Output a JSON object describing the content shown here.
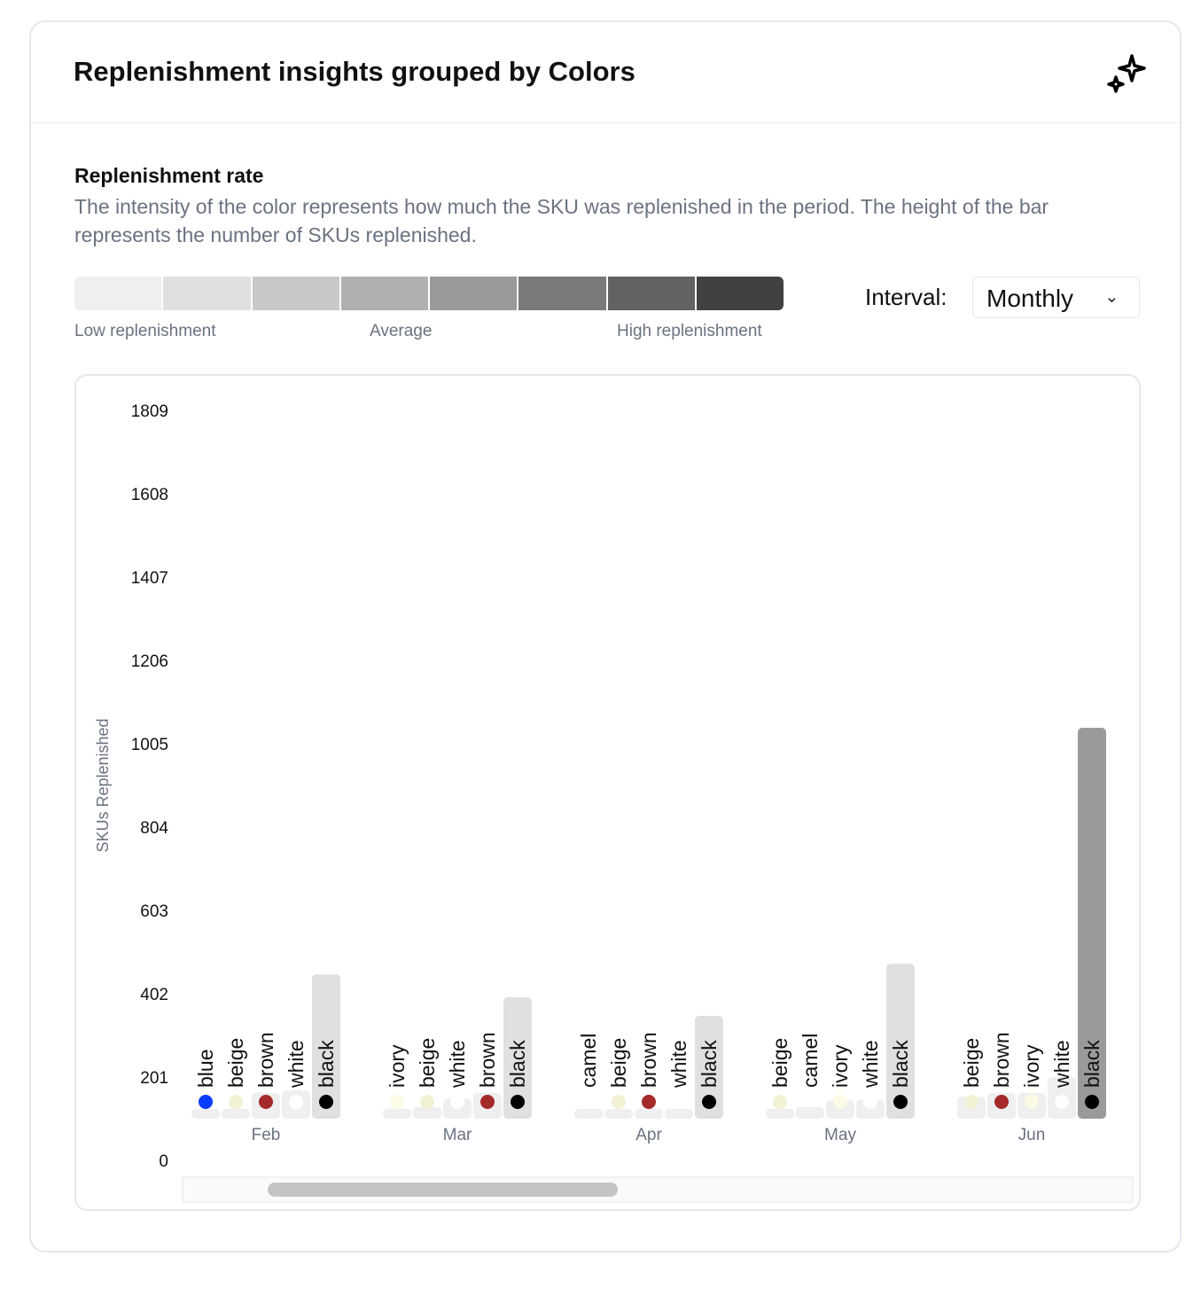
{
  "header": {
    "title": "Replenishment insights grouped by Colors",
    "icon": "sparkles-icon"
  },
  "section": {
    "title": "Replenishment rate",
    "description": "The intensity of the color represents how much the SKU was replenished in the period. The height of the bar represents the number of SKUs replenished."
  },
  "legend": {
    "colors": [
      "#efefef",
      "#e0e0e0",
      "#c8c8c8",
      "#b0b0b0",
      "#9a9a9a",
      "#7a7a7a",
      "#626262",
      "#414141"
    ],
    "low": "Low replenishment",
    "avg": "Average",
    "high": "High replenishment"
  },
  "interval": {
    "label": "Interval:",
    "value": "Monthly"
  },
  "chart_data": {
    "type": "bar",
    "ylabel": "SKUs Replenished",
    "yticks": [
      "0",
      "201",
      "402",
      "603",
      "804",
      "1005",
      "1206",
      "1407",
      "1608",
      "1809"
    ],
    "ylim": [
      0,
      1809
    ],
    "swatch_colors": {
      "blue": "#0a3cff",
      "beige": "#f2f1d6",
      "brown": "#a52a2a",
      "white": "#ffffff",
      "black": "#000000",
      "ivory": "#fbfbe6",
      "camel": null
    },
    "groups": [
      {
        "label": "Feb",
        "bars": [
          {
            "name": "blue",
            "value": 24,
            "level": 0
          },
          {
            "name": "beige",
            "value": 24,
            "level": 0
          },
          {
            "name": "brown",
            "value": 62,
            "level": 0
          },
          {
            "name": "white",
            "value": 68,
            "level": 0
          },
          {
            "name": "black",
            "value": 348,
            "level": 1
          }
        ]
      },
      {
        "label": "Mar",
        "bars": [
          {
            "name": "ivory",
            "value": 24,
            "level": 0
          },
          {
            "name": "beige",
            "value": 28,
            "level": 0
          },
          {
            "name": "white",
            "value": 49,
            "level": 0
          },
          {
            "name": "brown",
            "value": 62,
            "level": 0
          },
          {
            "name": "black",
            "value": 293,
            "level": 1
          }
        ]
      },
      {
        "label": "Apr",
        "bars": [
          {
            "name": "camel",
            "value": 24,
            "level": 0
          },
          {
            "name": "beige",
            "value": 24,
            "level": 0
          },
          {
            "name": "brown",
            "value": 24,
            "level": 0
          },
          {
            "name": "white",
            "value": 24,
            "level": 0
          },
          {
            "name": "black",
            "value": 248,
            "level": 1
          }
        ]
      },
      {
        "label": "May",
        "bars": [
          {
            "name": "beige",
            "value": 24,
            "level": 0
          },
          {
            "name": "camel",
            "value": 28,
            "level": 0
          },
          {
            "name": "ivory",
            "value": 45,
            "level": 0
          },
          {
            "name": "white",
            "value": 45,
            "level": 0
          },
          {
            "name": "black",
            "value": 374,
            "level": 1
          }
        ]
      },
      {
        "label": "Jun",
        "bars": [
          {
            "name": "beige",
            "value": 53,
            "level": 0
          },
          {
            "name": "brown",
            "value": 62,
            "level": 0
          },
          {
            "name": "ivory",
            "value": 62,
            "level": 0
          },
          {
            "name": "white",
            "value": 100,
            "level": 0
          },
          {
            "name": "black",
            "value": 943,
            "level": 4
          }
        ]
      }
    ]
  }
}
